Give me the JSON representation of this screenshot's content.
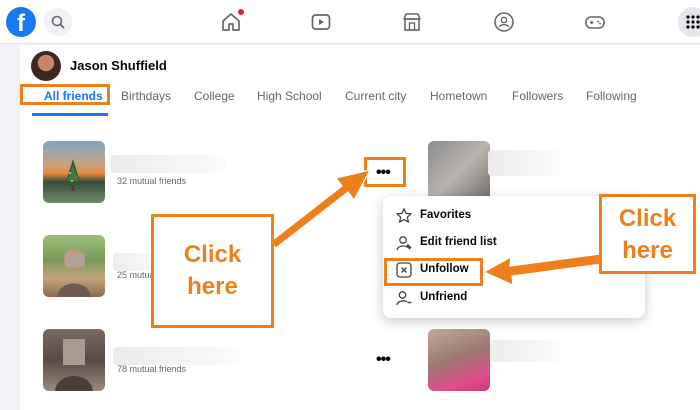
{
  "colors": {
    "accent": "#1877f2",
    "annotation": "#ef7f1a",
    "notification": "#e41e3f"
  },
  "topbar": {
    "logo_letter": "f",
    "nav_icons": [
      "home-icon",
      "video-icon",
      "marketplace-icon",
      "groups-icon",
      "gaming-icon"
    ],
    "home_has_notification": true
  },
  "profile": {
    "name": "Jason Shuffield"
  },
  "tabs": [
    {
      "label": "All friends",
      "active": true
    },
    {
      "label": "Birthdays"
    },
    {
      "label": "College"
    },
    {
      "label": "High School"
    },
    {
      "label": "Current city"
    },
    {
      "label": "Hometown"
    },
    {
      "label": "Followers"
    },
    {
      "label": "Following"
    }
  ],
  "friends": [
    {
      "mutual": "32 mutual friends"
    },
    {
      "mutual": "25 mutual friends"
    },
    {
      "mutual": "78 mutual friends"
    }
  ],
  "more_button": {
    "label": "•••"
  },
  "dropdown": {
    "items": [
      {
        "label": "Favorites",
        "icon": "star-icon"
      },
      {
        "label": "Edit friend list",
        "icon": "edit-friend-list-icon"
      },
      {
        "label": "Unfollow",
        "icon": "unfollow-icon"
      },
      {
        "label": "Unfriend",
        "icon": "unfriend-icon"
      }
    ]
  },
  "callouts": [
    {
      "line1": "Click",
      "line2": "here"
    },
    {
      "line1": "Click",
      "line2": "here"
    }
  ]
}
